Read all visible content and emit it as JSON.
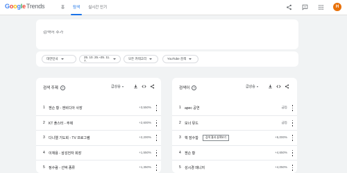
{
  "app": {
    "logo_google": [
      "G",
      "o",
      "o",
      "g",
      "l",
      "e"
    ],
    "logo_trends": "Trends"
  },
  "nav": {
    "tabs": [
      {
        "label": "홈",
        "active": false
      },
      {
        "label": "탐색",
        "active": true
      },
      {
        "label": "실시간 인기",
        "active": false
      }
    ]
  },
  "user": {
    "avatar_initial": "H",
    "avatar_color": "#e8710a"
  },
  "search": {
    "placeholder": "검색어 추가"
  },
  "filters": {
    "region": "대한민국",
    "date_range": "25. 10. 25.~25. 11. 7.",
    "category": "모든 카테고리",
    "property": "YouTube 검색"
  },
  "left_panel": {
    "title": "검색 주제",
    "sort": "급상승",
    "rows": [
      {
        "num": "1",
        "label": "젠슨 황 - 엔비디아 사장",
        "value": "+3,550%"
      },
      {
        "num": "2",
        "label": "KT 플스터 - 주제",
        "value": "+2,600%"
      },
      {
        "num": "3",
        "label": "다니엘 기도회 - TV 프로그램",
        "value": "+2,200%"
      },
      {
        "num": "4",
        "label": "이재용 - 삼성전자 회장",
        "value": "+1,550%"
      },
      {
        "num": "5",
        "label": "정수람 - 선박 종류",
        "value": "+1,350%"
      }
    ]
  },
  "right_panel": {
    "title": "검색어",
    "sort": "급상승",
    "tooltip": "검색 결과 살펴보기",
    "rows": [
      {
        "num": "1",
        "label": "apec 공연",
        "value": "급등"
      },
      {
        "num": "2",
        "label": "모너 뮤드",
        "value": "급등"
      },
      {
        "num": "3",
        "label": "핵 잠수함",
        "value": "+5,000%"
      },
      {
        "num": "4",
        "label": "젠슨 황",
        "value": "+4,650%"
      },
      {
        "num": "5",
        "label": "성시경 매니저",
        "value": "+4,050%"
      }
    ]
  },
  "colors": {
    "accent": "#1a73e8",
    "background": "#f1f3f4",
    "card": "#ffffff"
  },
  "icons": [
    "share-icon",
    "feedback-icon",
    "apps-grid-icon",
    "help-circle-icon",
    "download-icon",
    "embed-code-icon",
    "more-vert-icon"
  ]
}
